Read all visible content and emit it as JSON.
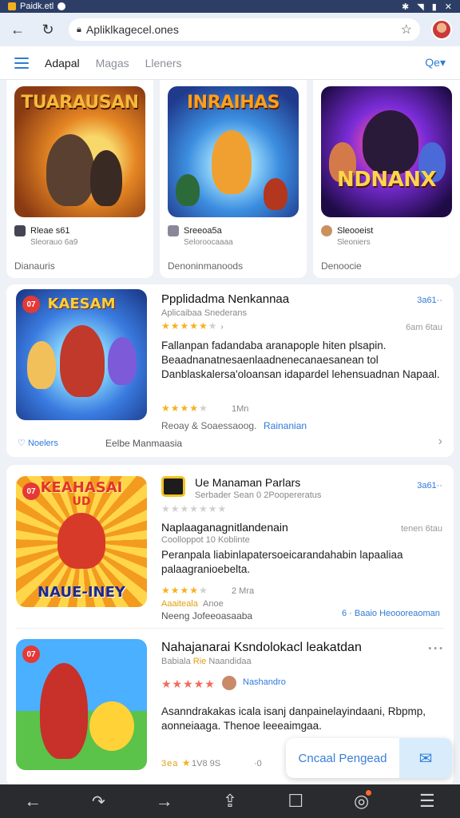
{
  "status": {
    "app_text": "Paidk.etl",
    "icons": [
      "app-icon",
      "notification-icon",
      "bluetooth-icon",
      "wifi-icon",
      "battery-icon",
      "close-icon"
    ]
  },
  "browser": {
    "url": "Apliklkagecel.ones"
  },
  "nav": {
    "tabs": [
      "Adapal",
      "Magas",
      "Lleners"
    ],
    "right_link": "Qe▾"
  },
  "featured": [
    {
      "art_title": "TUARAUSAN",
      "name": "Rleae s61",
      "sub": "Sleorauo 6a9",
      "category": "Dianauris",
      "colors": [
        "#f2b01e",
        "#8a3a12"
      ]
    },
    {
      "art_title": "INRAIHAS",
      "name": "Sreeoa5a",
      "sub": "Seloroocaaaa",
      "category": "Denoninmanoods",
      "colors": [
        "#3c8ee0",
        "#203a8c"
      ]
    },
    {
      "art_title": "NDNANX",
      "name": "Sleooeist",
      "sub": "Sleoniers",
      "category": "Denoocie",
      "colors": [
        "#7b2cd8",
        "#1e0b46"
      ]
    }
  ],
  "card1": {
    "thumb_title": "KAESAM",
    "badge": "07",
    "title": "Ppplidadma Nenkannaa",
    "subtitle": "Aplicaibaa Snederans",
    "price": "3a61··",
    "dist": "6am 6tau",
    "rating": 4,
    "desc": "Fallanpan fadandaba aranapople hiten plsapin. Beaadnanatnesaenlaadnenecanaesanean tol Danblaskalersa'oloansan idapardel lehensuadnan Napaal.",
    "rating2": 4,
    "rating2_label": "1Mn",
    "meta": "Reoay & Soaessaoog.",
    "meta_link": "Rainanian",
    "tag": "Noelers",
    "footer": "Eelbe Manmaasia",
    "chevron": "›"
  },
  "card2": {
    "thumb_title_top": "KEAHASAI",
    "thumb_title_mid": "UD",
    "thumb_title_bottom": "NAUE-INEY",
    "badge": "07",
    "pub_icon_title": "Ue Manaman Parlars",
    "pub_sub": "Serbader Sean 0 2Poopereratus",
    "price": "3a61··",
    "rating": 0,
    "title": "Naplaaganagnitlandenain",
    "subtitle": "Coolloppot 10 Koblinte",
    "dist": "tenen 6tau",
    "desc": "Peranpala liabinlapatersoeicarandahabin lapaaliaa palaagranioebelta.",
    "rating2": 4,
    "rating2_label": "2 Mra",
    "tag_gold": "Aaaiteala",
    "tag_note": "Anoe",
    "meta": "Neeng Jofeeoasaaba",
    "link_right": "6 · Baaio Heoooreaoman",
    "second": {
      "title": "Nahajanarai Ksndolokacl leakatdan",
      "subtitle_a": "Babiala",
      "subtitle_hl": "Rie",
      "subtitle_b": "Naandidaa",
      "stars_label": "Nashandro",
      "desc": "Asanndrakakas icala isanj danpainelayindaani, Rbpmp, aonneiaaga. Thenoe leeeaimgaa.",
      "price_gold": "3ea",
      "tag": "1V8 9S",
      "dot": "·0"
    },
    "more": "• • •"
  },
  "chat": {
    "label": "Cncaal Pengead"
  },
  "bottom_nav": [
    "back-icon",
    "forward-icon",
    "share-icon",
    "tabs-icon",
    "notifications-icon",
    "menu-icon"
  ]
}
